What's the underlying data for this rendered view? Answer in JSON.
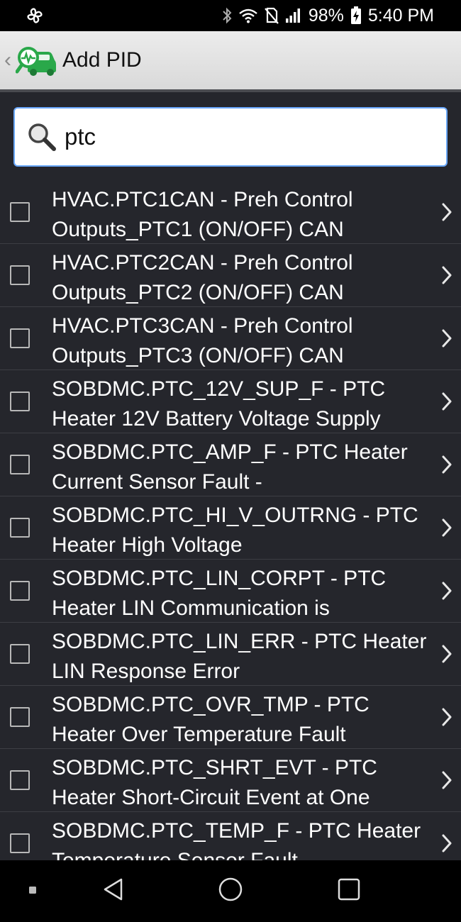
{
  "status_bar": {
    "battery_percent": "98%",
    "time": "5:40 PM"
  },
  "app_bar": {
    "title": "Add PID"
  },
  "search": {
    "value": "ptc"
  },
  "pid_list": [
    {
      "label": "HVAC.PTC1CAN - Preh Control Outputs_PTC1 (ON/OFF) CAN"
    },
    {
      "label": "HVAC.PTC2CAN - Preh Control Outputs_PTC2 (ON/OFF) CAN"
    },
    {
      "label": "HVAC.PTC3CAN - Preh Control Outputs_PTC3 (ON/OFF) CAN"
    },
    {
      "label": "SOBDMC.PTC_12V_SUP_F - PTC Heater 12V Battery Voltage Supply"
    },
    {
      "label": "SOBDMC.PTC_AMP_F - PTC Heater Current Sensor Fault -"
    },
    {
      "label": "SOBDMC.PTC_HI_V_OUTRNG - PTC Heater High Voltage"
    },
    {
      "label": "SOBDMC.PTC_LIN_CORPT - PTC Heater LIN Communication is"
    },
    {
      "label": "SOBDMC.PTC_LIN_ERR - PTC Heater LIN Response Error"
    },
    {
      "label": "SOBDMC.PTC_OVR_TMP - PTC Heater Over Temperature Fault"
    },
    {
      "label": "SOBDMC.PTC_SHRT_EVT - PTC Heater Short-Circuit Event at One"
    },
    {
      "label": "SOBDMC.PTC_TEMP_F - PTC Heater Temperature Sensor Fault"
    }
  ]
}
